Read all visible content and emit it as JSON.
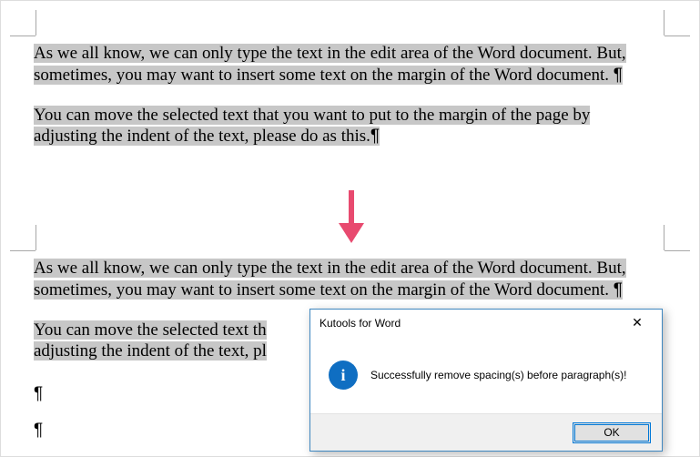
{
  "doc": {
    "para1_l1": "As we all know, we can only type the text in the edit area of the Word document. But,",
    "para1_l2": "sometimes, you may want to insert some text on the margin of the Word document. ",
    "para2_l1": "You can move the selected text that you want to put to the margin of the page by",
    "para2_l2": "adjusting the indent of the text, please do as this.",
    "pilcrow": "¶"
  },
  "doc2": {
    "para1_l1": "As we all know, we can only type the text in the edit area of the Word document. But,",
    "para1_l2": "sometimes, you may want to insert some text on the margin of the Word document. ",
    "para2_l1": "You can move the selected text th",
    "para2_l2": "adjusting the indent of the text, pl"
  },
  "dialog": {
    "title": "Kutools for Word",
    "message": "Successfully remove spacing(s) before paragraph(s)!",
    "ok": "OK",
    "close": "✕"
  }
}
